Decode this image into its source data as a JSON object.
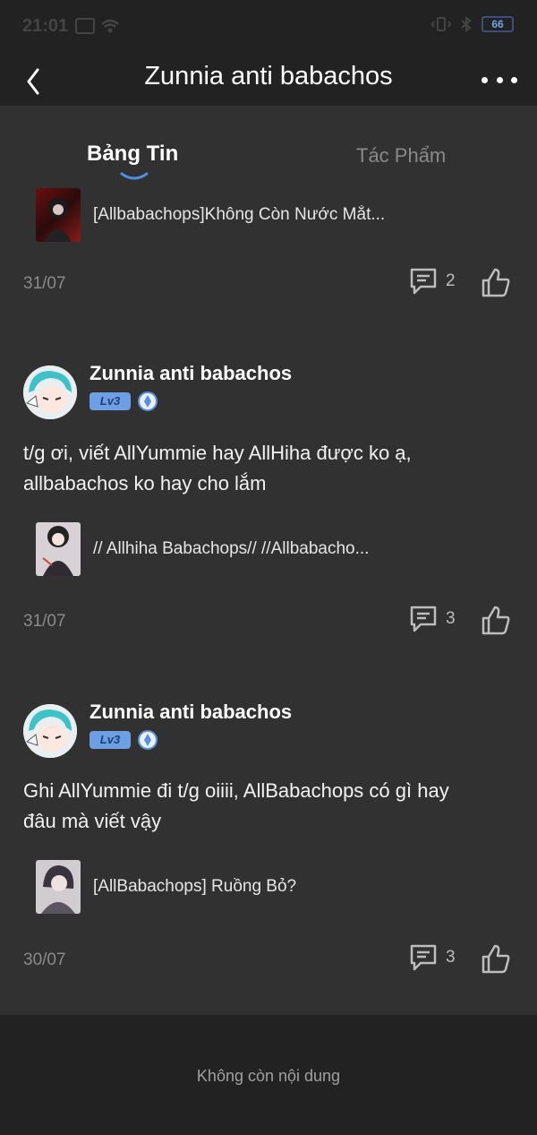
{
  "status_bar": {
    "time": "21:01",
    "battery": "66"
  },
  "header": {
    "title": "Zunnia anti babachos"
  },
  "tabs": [
    {
      "label": "Bảng Tin",
      "active": true
    },
    {
      "label": "Tác Phẩm",
      "active": false
    }
  ],
  "feed": {
    "top_item": {
      "work_title": "[Allbabachops]Không Còn Nước Mắt...",
      "date": "31/07",
      "comments": "2"
    },
    "posts": [
      {
        "author": "Zunnia anti babachos",
        "level": "Lv3",
        "text_line1": "t/g ơi, viết AllYummie hay AllHiha được ko ạ,",
        "text_line2": "allbabachos ko hay cho lắm",
        "work_title": "// Allhiha Babachops// //Allbabacho...",
        "date": "31/07",
        "comments": "3"
      },
      {
        "author": "Zunnia anti babachos",
        "level": "Lv3",
        "text_line1": "Ghi AllYummie đi t/g oiiii, AllBabachops có gì hay",
        "text_line2": "đâu mà viết vậy",
        "work_title": "[AllBabachops] Ruồng Bỏ?",
        "date": "30/07",
        "comments": "3"
      }
    ]
  },
  "footer": {
    "text": "Không còn nội dung"
  },
  "colors": {
    "accent": "#4a90e2",
    "level_badge": "#6e9fe4",
    "background": "#313131"
  }
}
